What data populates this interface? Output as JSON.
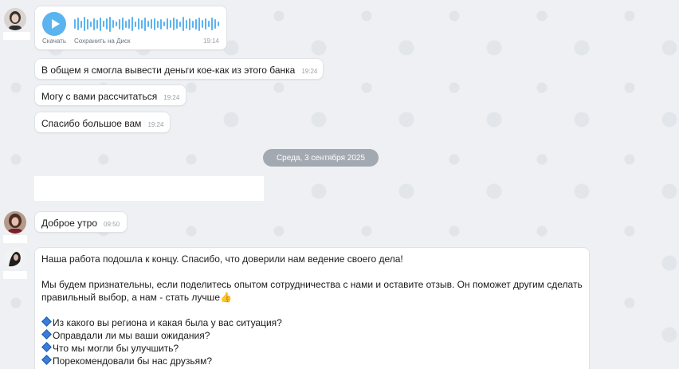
{
  "voice_message": {
    "download_label": "Скачать",
    "save_label": "Сохранить на Диск",
    "time": "19:14"
  },
  "messages_before": [
    {
      "text": "В общем я смогла вывести деньги кое-как из этого банка",
      "time": "19:24"
    },
    {
      "text": "Могу с вами рассчитаться",
      "time": "19:24"
    },
    {
      "text": "Спасибо большое вам",
      "time": "19:24"
    }
  ],
  "date_divider": "Среда, 3 сентября 2025",
  "greeting": {
    "text": "Доброе утро",
    "time": "09:50"
  },
  "long_message": {
    "line1": "Наша работа подошла к концу. Спасибо, что доверили нам ведение своего дела!",
    "line2": "Мы будем признательны, если поделитесь опытом сотрудничества с нами и оставите отзыв. Он поможет другим сделать",
    "line3": "правильный выбор, а нам - стать лучше",
    "thumb": "👍",
    "questions": [
      "Из какого вы региона и какая была у вас ситуация?",
      "Оправдали ли мы ваши ожидания?",
      "Что мы могли бы улучшить?",
      "Порекомендовали бы нас друзьям?"
    ]
  }
}
